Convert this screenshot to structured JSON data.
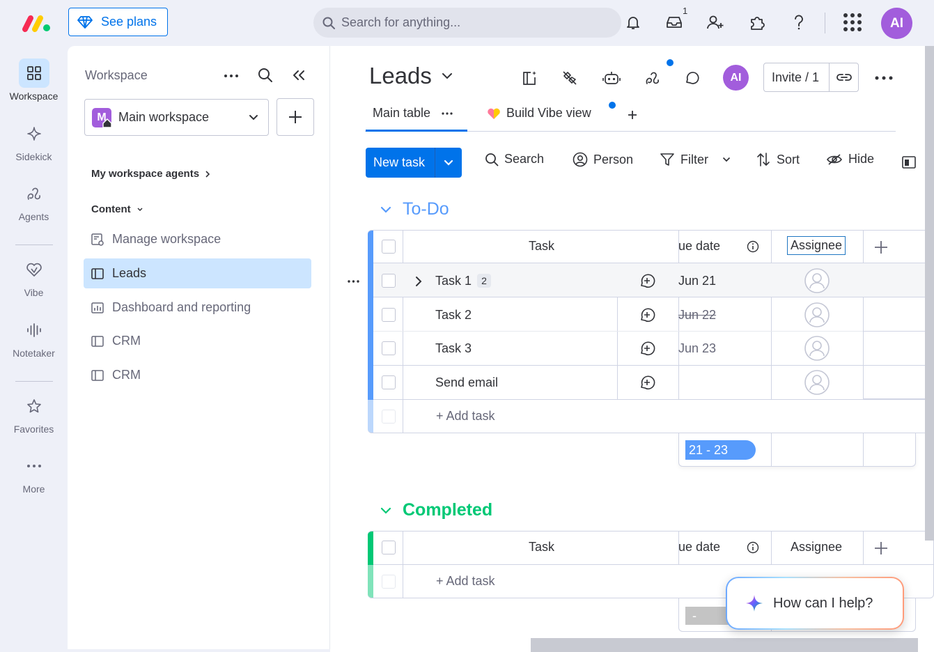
{
  "topbar": {
    "see_plans": "See plans",
    "search_placeholder": "Search for anything...",
    "inbox_count": "1",
    "user_initials": "AI"
  },
  "rail": {
    "workspace": "Workspace",
    "sidekick": "Sidekick",
    "agents": "Agents",
    "vibe": "Vibe",
    "notetaker": "Notetaker",
    "favorites": "Favorites",
    "more": "More"
  },
  "workspace_panel": {
    "title": "Workspace",
    "selected_workspace": "Main workspace",
    "workspace_badge": "M",
    "agents_link": "My workspace agents",
    "content_label": "Content",
    "items": [
      {
        "label": "Manage workspace"
      },
      {
        "label": "Leads"
      },
      {
        "label": "Dashboard and reporting"
      },
      {
        "label": "CRM"
      },
      {
        "label": "CRM"
      }
    ]
  },
  "board": {
    "title": "Leads",
    "user_initials": "AI",
    "invite_label": "Invite / 1",
    "tabs": [
      {
        "label": "Main table"
      },
      {
        "label": "Build Vibe view"
      }
    ],
    "toolbar": {
      "new_task": "New task",
      "search": "Search",
      "person": "Person",
      "filter": "Filter",
      "sort": "Sort",
      "hide": "Hide"
    },
    "columns": {
      "task": "Task",
      "due_date": "ue date",
      "assignee": "Assignee"
    },
    "groups": [
      {
        "title": "To-Do",
        "color": "#579bfc",
        "rows": [
          {
            "name": "Task 1",
            "subitems": "2",
            "due": "Jun 21"
          },
          {
            "name": "Task 2",
            "due": "Jun 22"
          },
          {
            "name": "Task 3",
            "due": "Jun 23"
          },
          {
            "name": "Send email",
            "due": ""
          }
        ],
        "add_label": "+ Add task",
        "summary_range": "21 - 23"
      },
      {
        "title": "Completed",
        "color": "#00c875",
        "rows": [],
        "add_label": "+ Add task",
        "summary_range": "-"
      }
    ]
  },
  "help": {
    "label": "How can I help?"
  }
}
